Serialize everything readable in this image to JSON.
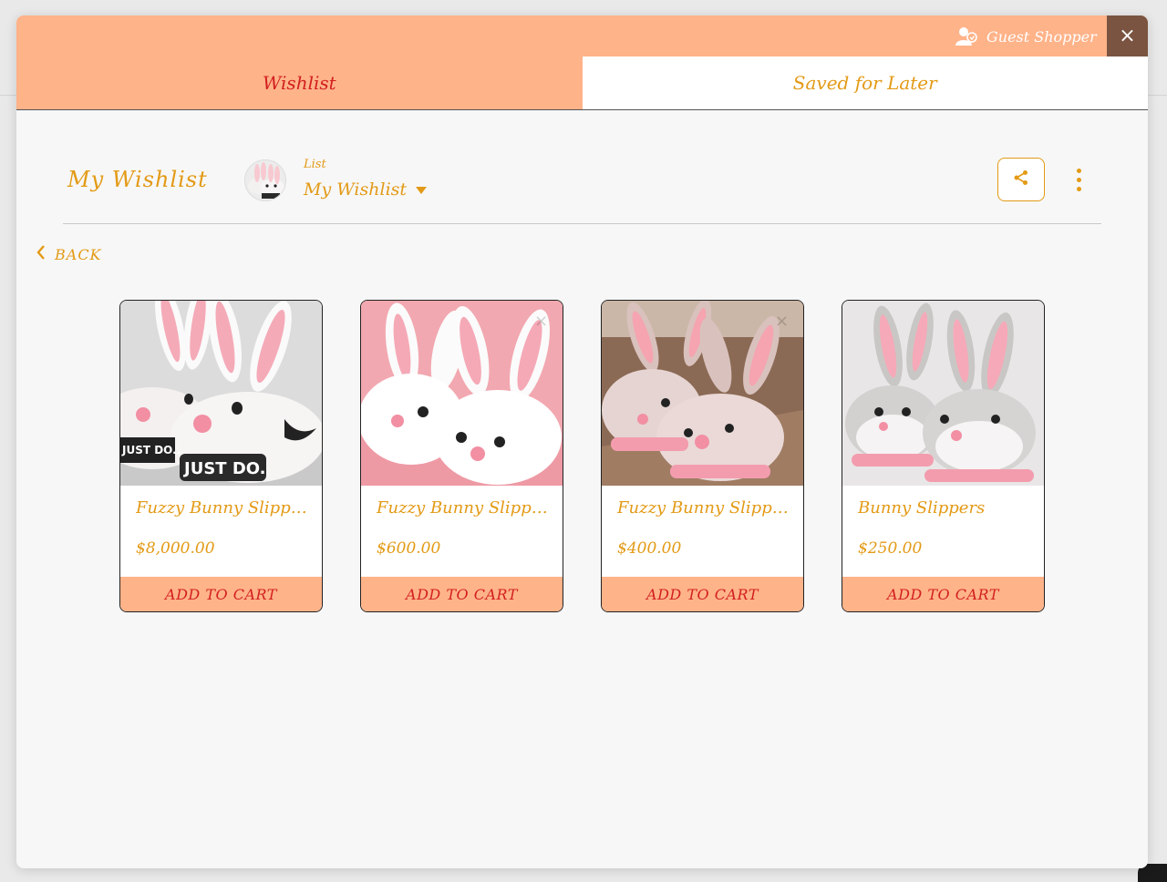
{
  "header": {
    "guest_label": "Guest Shopper",
    "close_label": "×"
  },
  "tabs": [
    {
      "label": "Wishlist",
      "active": true
    },
    {
      "label": "Saved for Later",
      "active": false
    }
  ],
  "wishlist": {
    "title": "My Wishlist",
    "list_label": "List",
    "selected_list": "My Wishlist",
    "back_label": "BACK"
  },
  "products": [
    {
      "name": "Fuzzy Bunny Slipper",
      "name_display": "Fuzzy Bunny Slippe...",
      "price": "$8,000.00",
      "button": "ADD TO CART",
      "image": "gray-bunny-slippers-just-do"
    },
    {
      "name": "Fuzzy Bunny Slipper",
      "name_display": "Fuzzy Bunny Slippe...",
      "price": "$600.00",
      "button": "ADD TO CART",
      "image": "white-fluffy-bunny-slippers"
    },
    {
      "name": "Fuzzy Bunny Slipper",
      "name_display": "Fuzzy Bunny Slippe...",
      "price": "$400.00",
      "button": "ADD TO CART",
      "image": "brown-bunny-slippers-on-wood"
    },
    {
      "name": "Bunny Slippers",
      "name_display": "Bunny Slippers",
      "price": "$250.00",
      "button": "ADD TO CART",
      "image": "gray-pink-bunny-slippers"
    }
  ],
  "colors": {
    "accent_peach": "#ffb389",
    "accent_gold": "#e39a16",
    "accent_red": "#d22020",
    "close_brown": "#7a5440"
  }
}
